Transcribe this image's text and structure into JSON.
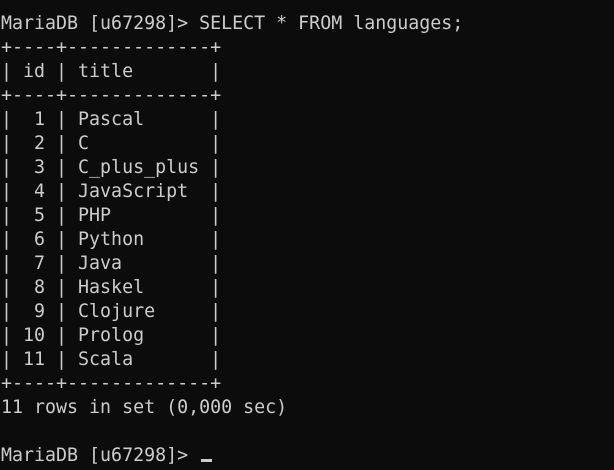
{
  "terminal": {
    "prompt": "MariaDB [u67298]>",
    "command": "SELECT * FROM languages;",
    "border": "+----+-------------+",
    "header": "| id | title       |",
    "rows": [
      "|  1 | Pascal      |",
      "|  2 | C           |",
      "|  3 | C_plus_plus |",
      "|  4 | JavaScript  |",
      "|  5 | PHP         |",
      "|  6 | Python      |",
      "|  7 | Java        |",
      "|  8 | Haskel      |",
      "|  9 | Clojure     |",
      "| 10 | Prolog      |",
      "| 11 | Scala       |"
    ],
    "result": "11 rows in set (0,000 sec)",
    "prompt_final": "MariaDB [u67298]>"
  },
  "colors": {
    "background": "#0c0c0c",
    "text": "#cccccc"
  }
}
